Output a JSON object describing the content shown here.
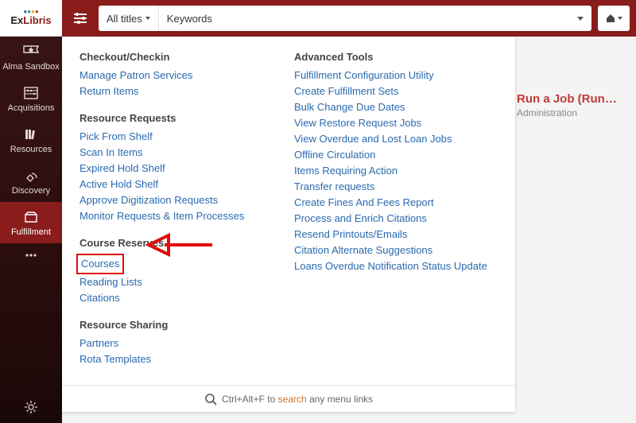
{
  "logo": {
    "part1": "Ex",
    "part2": "Libris"
  },
  "sidebar": {
    "items": [
      {
        "label": "Alma Sandbox"
      },
      {
        "label": "Acquisitions"
      },
      {
        "label": "Resources"
      },
      {
        "label": "Discovery"
      },
      {
        "label": "Fulfillment"
      }
    ]
  },
  "topbar": {
    "scope": "All titles",
    "mode": "Keywords"
  },
  "side_info": {
    "title": "Run a Job (Run…",
    "subtitle": "Administration"
  },
  "menu": {
    "left": [
      {
        "header": "Checkout/Checkin",
        "items": [
          "Manage Patron Services",
          "Return Items"
        ]
      },
      {
        "header": "Resource Requests",
        "items": [
          "Pick From Shelf",
          "Scan In Items",
          "Expired Hold Shelf",
          "Active Hold Shelf",
          "Approve Digitization Requests",
          "Monitor Requests & Item Processes"
        ]
      },
      {
        "header": "Course Reserves",
        "items": [
          "Courses",
          "Reading Lists",
          "Citations"
        ]
      },
      {
        "header": "Resource Sharing",
        "items": [
          "Partners",
          "Rota Templates"
        ]
      }
    ],
    "right": [
      {
        "header": "Advanced Tools",
        "items": [
          "Fulfillment Configuration Utility",
          "Create Fulfillment Sets",
          "Bulk Change Due Dates",
          "View Restore Request Jobs",
          "View Overdue and Lost Loan Jobs",
          "Offline Circulation",
          "Items Requiring Action",
          "Transfer requests",
          "Create Fines And Fees Report",
          "Process and Enrich Citations",
          "Resend Printouts/Emails",
          "Citation Alternate Suggestions",
          "Loans Overdue Notification Status Update"
        ]
      }
    ]
  },
  "footer": {
    "pre": "Ctrl+Alt+F to ",
    "hl": "search",
    "post": " any menu links"
  }
}
